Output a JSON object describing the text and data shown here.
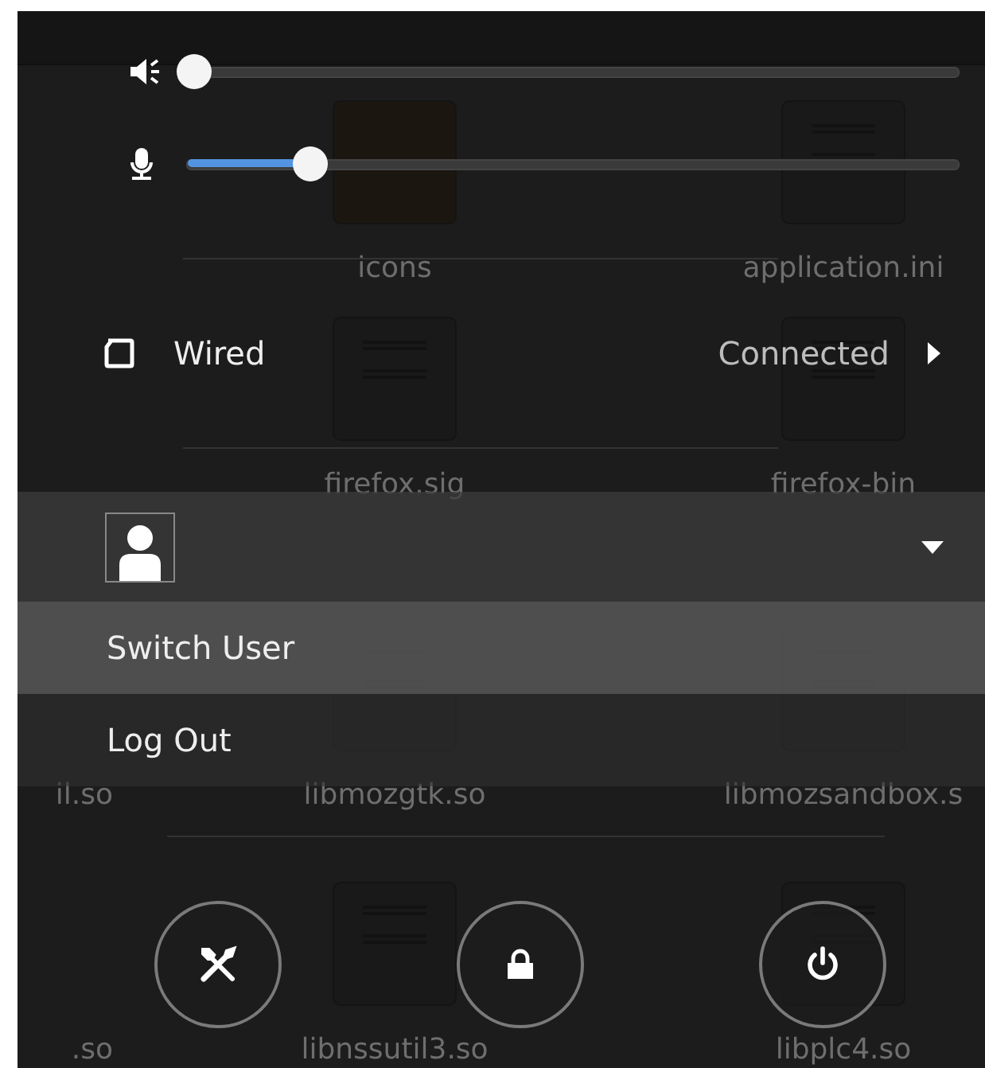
{
  "volume": {
    "output": {
      "level": 0
    },
    "input": {
      "level": 0.16
    }
  },
  "network": {
    "label": "Wired",
    "status": "Connected"
  },
  "user_menu": {
    "expanded": true,
    "items": [
      {
        "label": "Switch User",
        "selected": true
      },
      {
        "label": "Log Out",
        "selected": false
      }
    ]
  },
  "actions": [
    {
      "kind": "settings"
    },
    {
      "kind": "lock"
    },
    {
      "kind": "power"
    }
  ],
  "background_files": [
    {
      "label": "icons",
      "kind": "folder"
    },
    {
      "label": "application.ini",
      "kind": "document"
    },
    {
      "label": "firefox.sig",
      "kind": "document"
    },
    {
      "label": "firefox-bin",
      "kind": "document"
    },
    {
      "label": "il.so",
      "kind": "none"
    },
    {
      "label": "libmozgtk.so",
      "kind": "document"
    },
    {
      "label": "libmozsandbox.s",
      "kind": "document"
    },
    {
      "label": ".so",
      "kind": "none"
    },
    {
      "label": "libnssutil3.so",
      "kind": "document"
    },
    {
      "label": "libplc4.so",
      "kind": "document"
    }
  ]
}
